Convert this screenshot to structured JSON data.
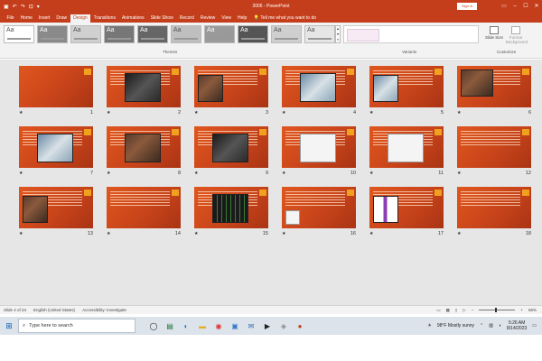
{
  "app": {
    "doc_title": "3006 - PowerPoint",
    "sign_in": "Sign in"
  },
  "tabs": [
    "File",
    "Home",
    "Insert",
    "Draw",
    "Design",
    "Transitions",
    "Animations",
    "Slide Show",
    "Record",
    "Review",
    "View",
    "Help"
  ],
  "active_tab": "Design",
  "tell_me": "Tell me what you want to do",
  "ribbon": {
    "themes_label": "Themes",
    "variants_label": "Variants",
    "customize_label": "Customize",
    "slide_size": "Slide Size",
    "format_background": "Format Background",
    "theme_glyph": "Aa"
  },
  "slides": [
    {
      "number": "6"
    },
    {
      "number": "5"
    },
    {
      "number": "4"
    },
    {
      "number": "3"
    },
    {
      "number": "2"
    },
    {
      "number": "1"
    },
    {
      "number": "12"
    },
    {
      "number": "11"
    },
    {
      "number": "10"
    },
    {
      "number": "9"
    },
    {
      "number": "8"
    },
    {
      "number": "7"
    },
    {
      "number": "18"
    },
    {
      "number": "17"
    },
    {
      "number": "16"
    },
    {
      "number": "15"
    },
    {
      "number": "14"
    },
    {
      "number": "13"
    }
  ],
  "status": {
    "slide_of": "Slide 4 of 24",
    "language": "English (United States)",
    "accessibility": "Accessibility: Investigate",
    "zoom": "66%"
  },
  "taskbar": {
    "search_placeholder": "Type here to search",
    "weather": "98°F  Mostly sunny",
    "time": "5:26 AM",
    "date": "8/14/2023"
  },
  "colors": {
    "accent": "#c43e1c",
    "slide_bg": "#c8441a",
    "slide_accent": "#f0a11f"
  }
}
